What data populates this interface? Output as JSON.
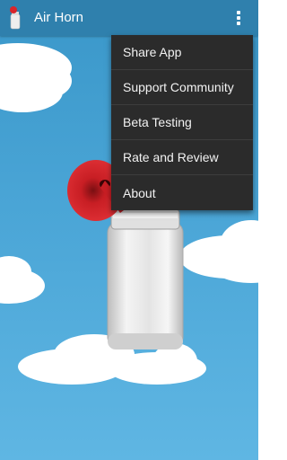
{
  "app": {
    "title": "Air Horn"
  },
  "menu": {
    "items": [
      {
        "label": "Share App"
      },
      {
        "label": "Support Community"
      },
      {
        "label": "Beta Testing"
      },
      {
        "label": "Rate and Review"
      },
      {
        "label": "About"
      }
    ]
  },
  "colors": {
    "action_bar": "#2f80ad",
    "sky_top": "#3a97c9",
    "sky_bottom": "#5fb6e3",
    "menu_background": "#2b2b2b",
    "horn_red": "#d9252b",
    "can_silver": "#e2e2e2"
  },
  "icons": {
    "app_icon": "air-horn-icon",
    "overflow": "overflow-menu-icon"
  }
}
